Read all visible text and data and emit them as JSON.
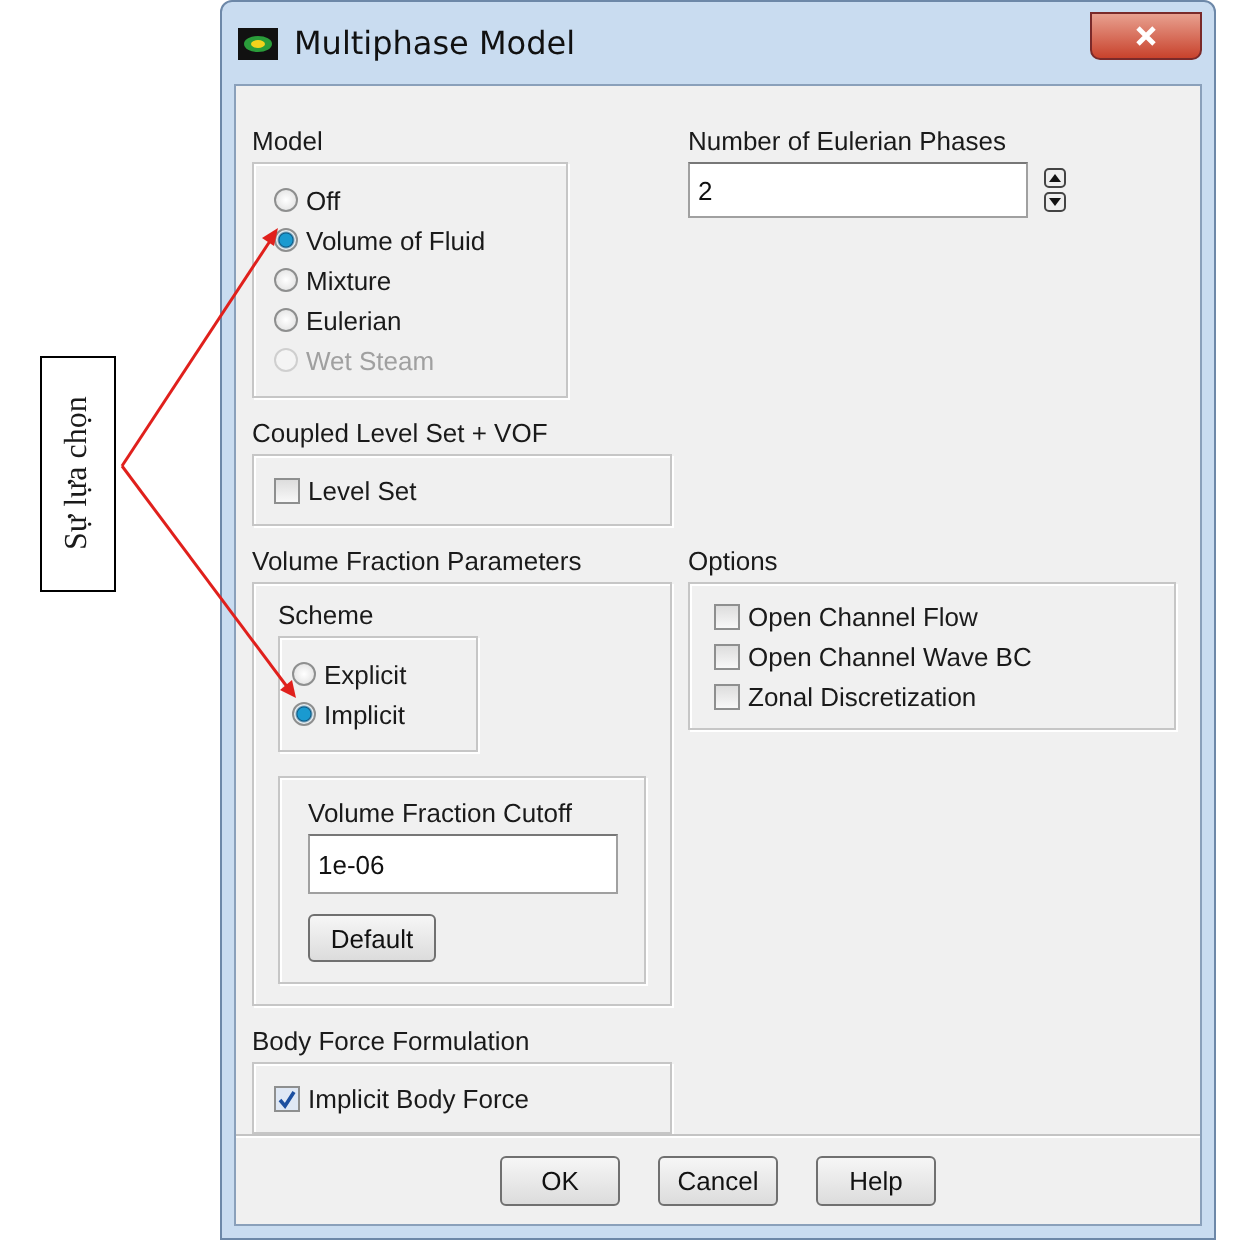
{
  "annotation": {
    "label": "Sự lựa chọn"
  },
  "window": {
    "title": "Multiphase Model"
  },
  "model": {
    "label": "Model",
    "options": [
      {
        "label": "Off",
        "selected": false,
        "disabled": false
      },
      {
        "label": "Volume of Fluid",
        "selected": true,
        "disabled": false
      },
      {
        "label": "Mixture",
        "selected": false,
        "disabled": false
      },
      {
        "label": "Eulerian",
        "selected": false,
        "disabled": false
      },
      {
        "label": "Wet Steam",
        "selected": false,
        "disabled": true
      }
    ]
  },
  "eulerian_phases": {
    "label": "Number of Eulerian Phases",
    "value": "2"
  },
  "coupled_level_set": {
    "label": "Coupled Level Set + VOF",
    "items": [
      {
        "label": "Level Set",
        "checked": false
      }
    ]
  },
  "volume_fraction": {
    "label": "Volume Fraction Parameters",
    "scheme": {
      "label": "Scheme",
      "options": [
        {
          "label": "Explicit",
          "selected": false,
          "disabled": false
        },
        {
          "label": "Implicit",
          "selected": true,
          "disabled": false
        }
      ]
    },
    "cutoff": {
      "label": "Volume Fraction Cutoff",
      "value": "1e-06",
      "button": "Default"
    }
  },
  "options": {
    "label": "Options",
    "items": [
      {
        "label": "Open Channel Flow",
        "checked": false
      },
      {
        "label": "Open Channel Wave BC",
        "checked": false
      },
      {
        "label": "Zonal Discretization",
        "checked": false
      }
    ]
  },
  "body_force": {
    "label": "Body Force Formulation",
    "items": [
      {
        "label": "Implicit Body Force",
        "checked": true
      }
    ]
  },
  "buttons": [
    "OK",
    "Cancel",
    "Help"
  ]
}
